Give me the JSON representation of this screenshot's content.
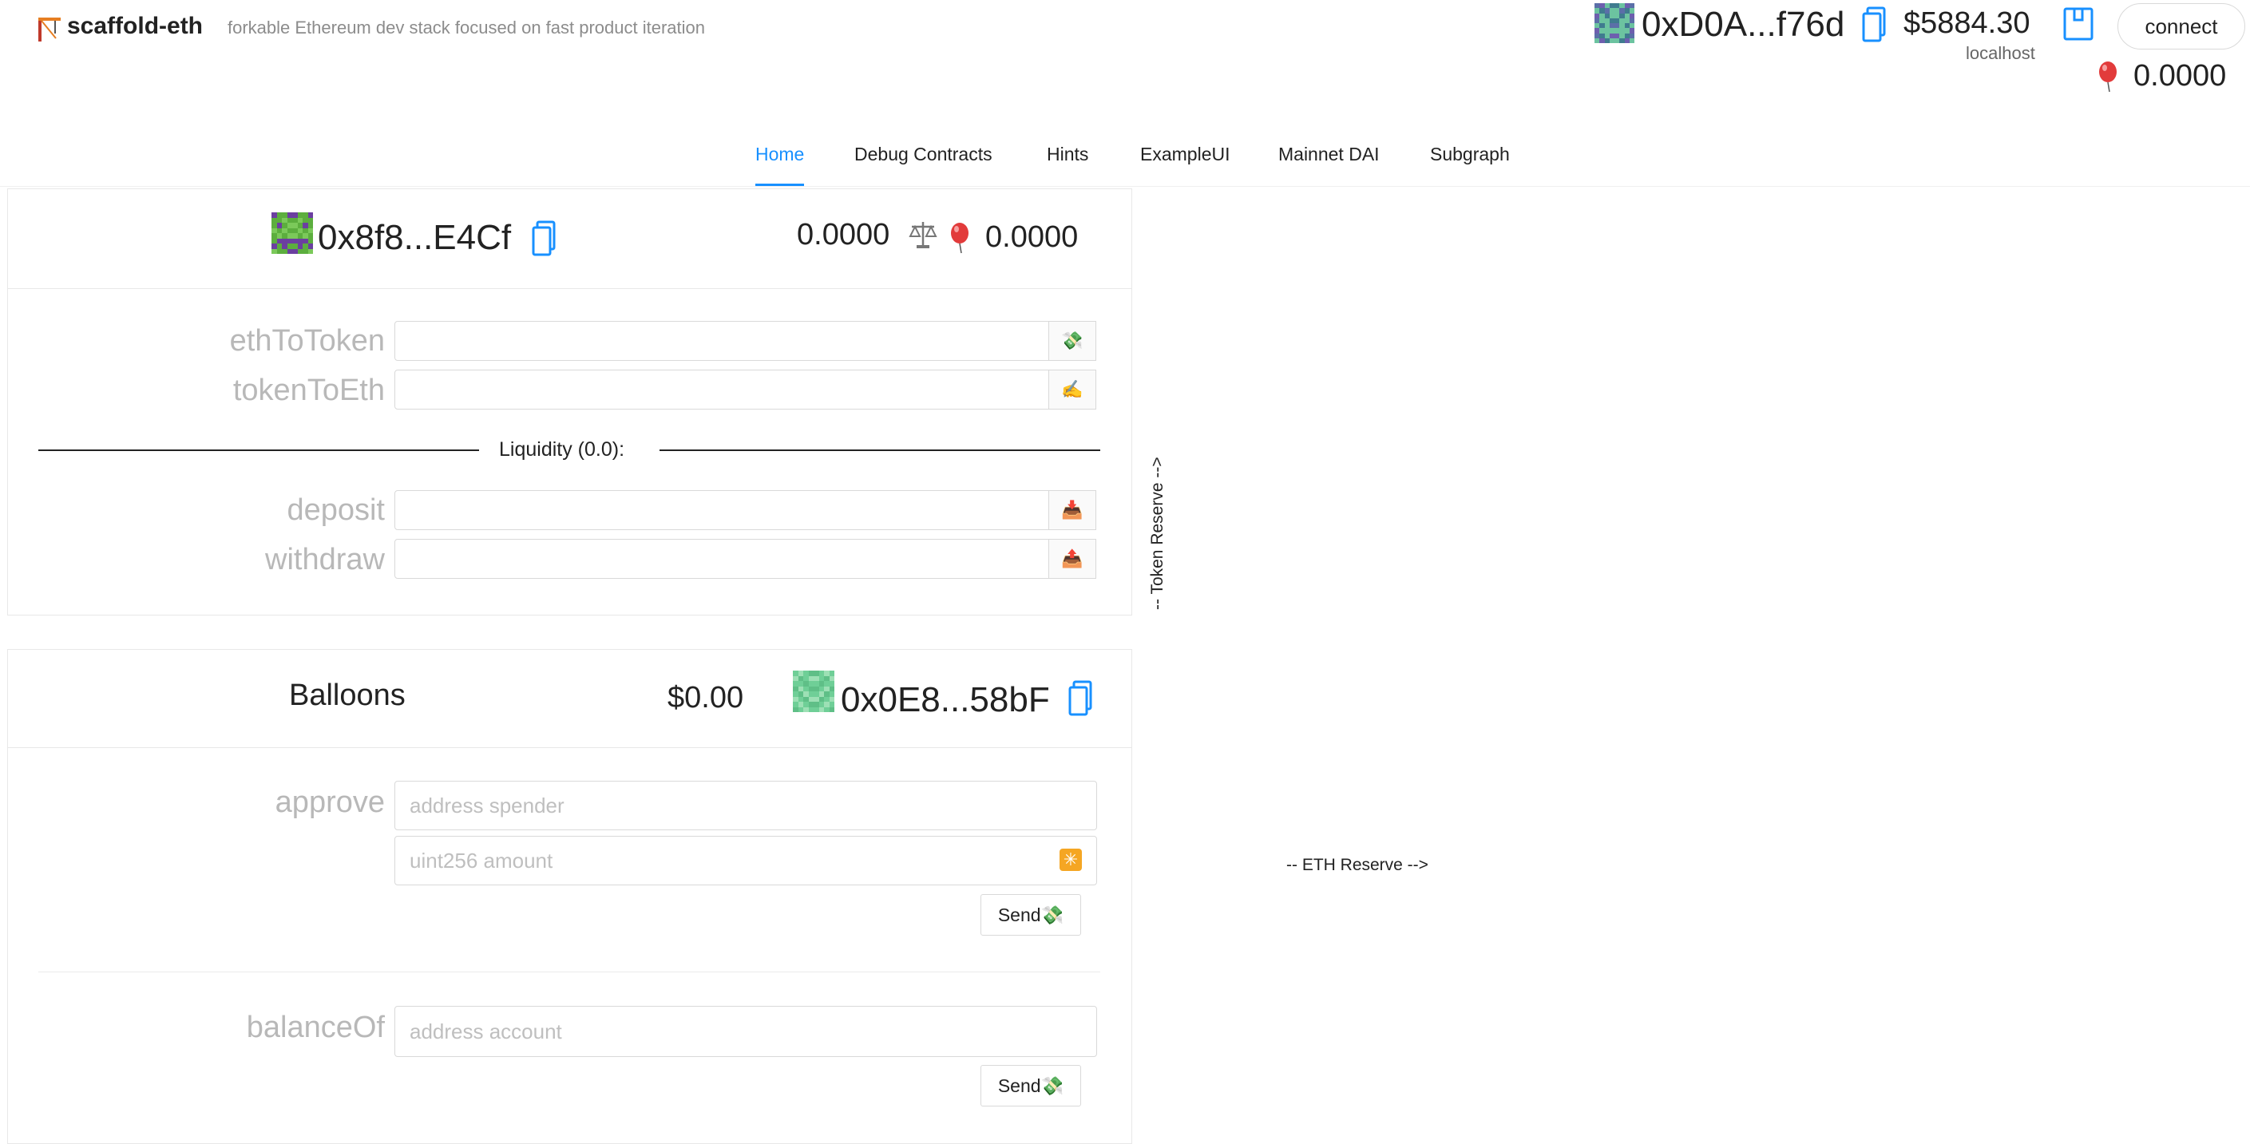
{
  "header": {
    "brand_icon": "construction-crane-icon",
    "title": "scaffold-eth",
    "subtitle": "forkable Ethereum dev stack focused on fast product iteration",
    "account": {
      "address": "0xD0A...f76d",
      "usd_balance": "$5884.30",
      "network": "localhost",
      "balloon_balance": "0.0000"
    },
    "connect_label": "connect"
  },
  "nav": {
    "tabs": [
      {
        "label": "Home"
      },
      {
        "label": "Debug Contracts"
      },
      {
        "label": "Hints"
      },
      {
        "label": "ExampleUI"
      },
      {
        "label": "Mainnet DAI"
      },
      {
        "label": "Subgraph"
      }
    ],
    "active": "Home"
  },
  "dex": {
    "address": "0x8f8...E4Cf",
    "eth_balance": "0.0000",
    "token_balance": "0.0000",
    "functions": [
      {
        "label": "ethToToken",
        "icon": "money-wings-icon",
        "value": ""
      },
      {
        "label": "tokenToEth",
        "icon": "pen-icon",
        "value": ""
      }
    ],
    "liquidity_label": "Liquidity (0.0):",
    "liquidity_functions": [
      {
        "label": "deposit",
        "icon": "inbox-tray-icon",
        "value": ""
      },
      {
        "label": "withdraw",
        "icon": "outbox-tray-icon",
        "value": ""
      }
    ]
  },
  "balloons": {
    "title": "Balloons",
    "usd_value": "$0.00",
    "address": "0x0E8...58bF",
    "approve": {
      "label": "approve",
      "spender_placeholder": "address spender",
      "amount_placeholder": "uint256 amount",
      "send_label": "Send💸"
    },
    "balanceOf": {
      "label": "balanceOf",
      "account_placeholder": "address account",
      "send_label": "Send💸"
    }
  },
  "curve": {
    "y_label": "-- Token Reserve -->",
    "x_label": "-- ETH Reserve -->"
  },
  "colors": {
    "accent": "#1890ff",
    "copy_icon": "#1890ff"
  }
}
